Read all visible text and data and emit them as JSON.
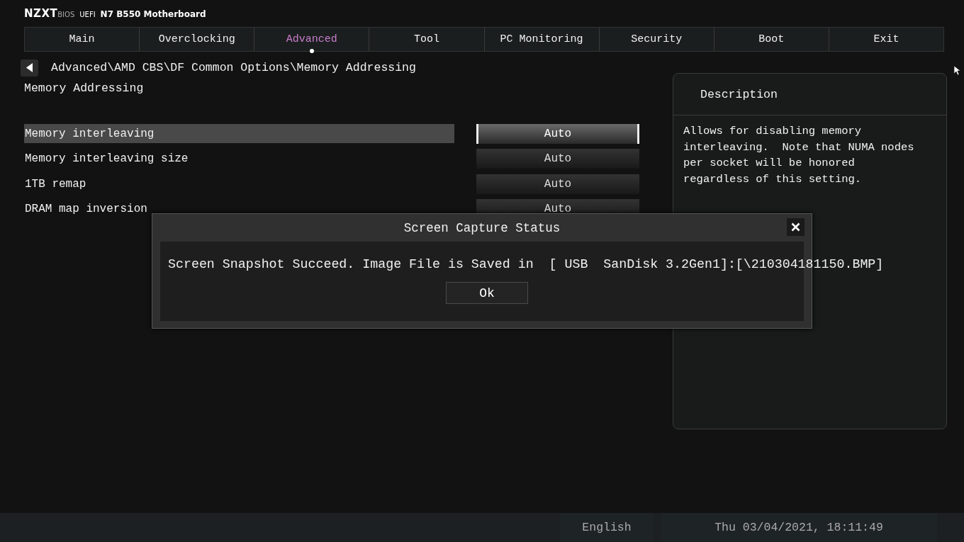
{
  "header": {
    "brand": "NZXT",
    "brand_suffix": "BIOS",
    "firmware": "UEFI",
    "board": "N7 B550 Motherboard"
  },
  "tabs": [
    {
      "label": "Main",
      "selected": false
    },
    {
      "label": "Overclocking",
      "selected": false
    },
    {
      "label": "Advanced",
      "selected": true
    },
    {
      "label": "Tool",
      "selected": false
    },
    {
      "label": "PC Monitoring",
      "selected": false
    },
    {
      "label": "Security",
      "selected": false
    },
    {
      "label": "Boot",
      "selected": false
    },
    {
      "label": "Exit",
      "selected": false
    }
  ],
  "breadcrumb": "Advanced\\AMD CBS\\DF Common Options\\Memory Addressing",
  "page_title": "Memory Addressing",
  "settings": [
    {
      "label": "Memory interleaving",
      "value": "Auto",
      "selected": true
    },
    {
      "label": "Memory interleaving size",
      "value": "Auto",
      "selected": false
    },
    {
      "label": "1TB remap",
      "value": "Auto",
      "selected": false
    },
    {
      "label": "DRAM map inversion",
      "value": "Auto",
      "selected": false
    }
  ],
  "description": {
    "title": "Description",
    "text": "Allows for disabling memory interleaving.  Note that NUMA nodes per socket will be honored regardless of this setting."
  },
  "dialog": {
    "title": "Screen Capture Status",
    "message": "Screen Snapshot Succeed. Image File is Saved in  [ USB  SanDisk 3.2Gen1]:[\\210304181150.BMP]",
    "button": "Ok"
  },
  "status_bar": {
    "language": "English",
    "datetime": "Thu 03/04/2021, 18:11:49"
  }
}
